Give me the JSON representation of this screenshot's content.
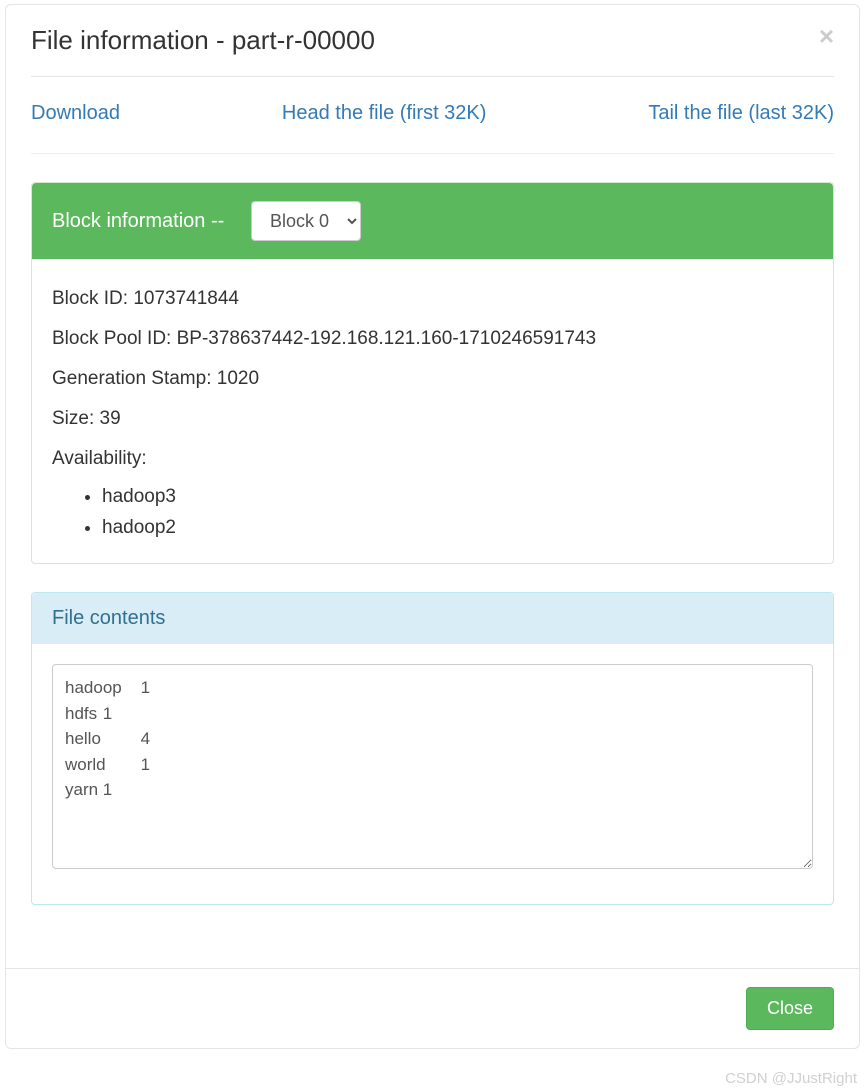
{
  "modal": {
    "title": "File information - part-r-00000",
    "close_x": "×"
  },
  "links": {
    "download": "Download",
    "head": "Head the file (first 32K)",
    "tail": "Tail the file (last 32K)"
  },
  "block_panel": {
    "heading_prefix": "Block information --   ",
    "selected_option": "Block 0",
    "options": [
      "Block 0"
    ],
    "fields": {
      "block_id_label": "Block ID: ",
      "block_id_value": "1073741844",
      "block_pool_id_label": "Block Pool ID: ",
      "block_pool_id_value": "BP-378637442-192.168.121.160-1710246591743",
      "generation_stamp_label": "Generation Stamp: ",
      "generation_stamp_value": "1020",
      "size_label": "Size: ",
      "size_value": "39",
      "availability_label": "Availability:"
    },
    "availability": [
      "hadoop3",
      "hadoop2"
    ]
  },
  "file_contents_panel": {
    "heading": "File contents",
    "text": "hadoop\t1\nhdfs\t1\nhello\t4\nworld\t1\nyarn\t1"
  },
  "footer": {
    "close_label": "Close"
  },
  "watermark": "CSDN @JJustRight"
}
